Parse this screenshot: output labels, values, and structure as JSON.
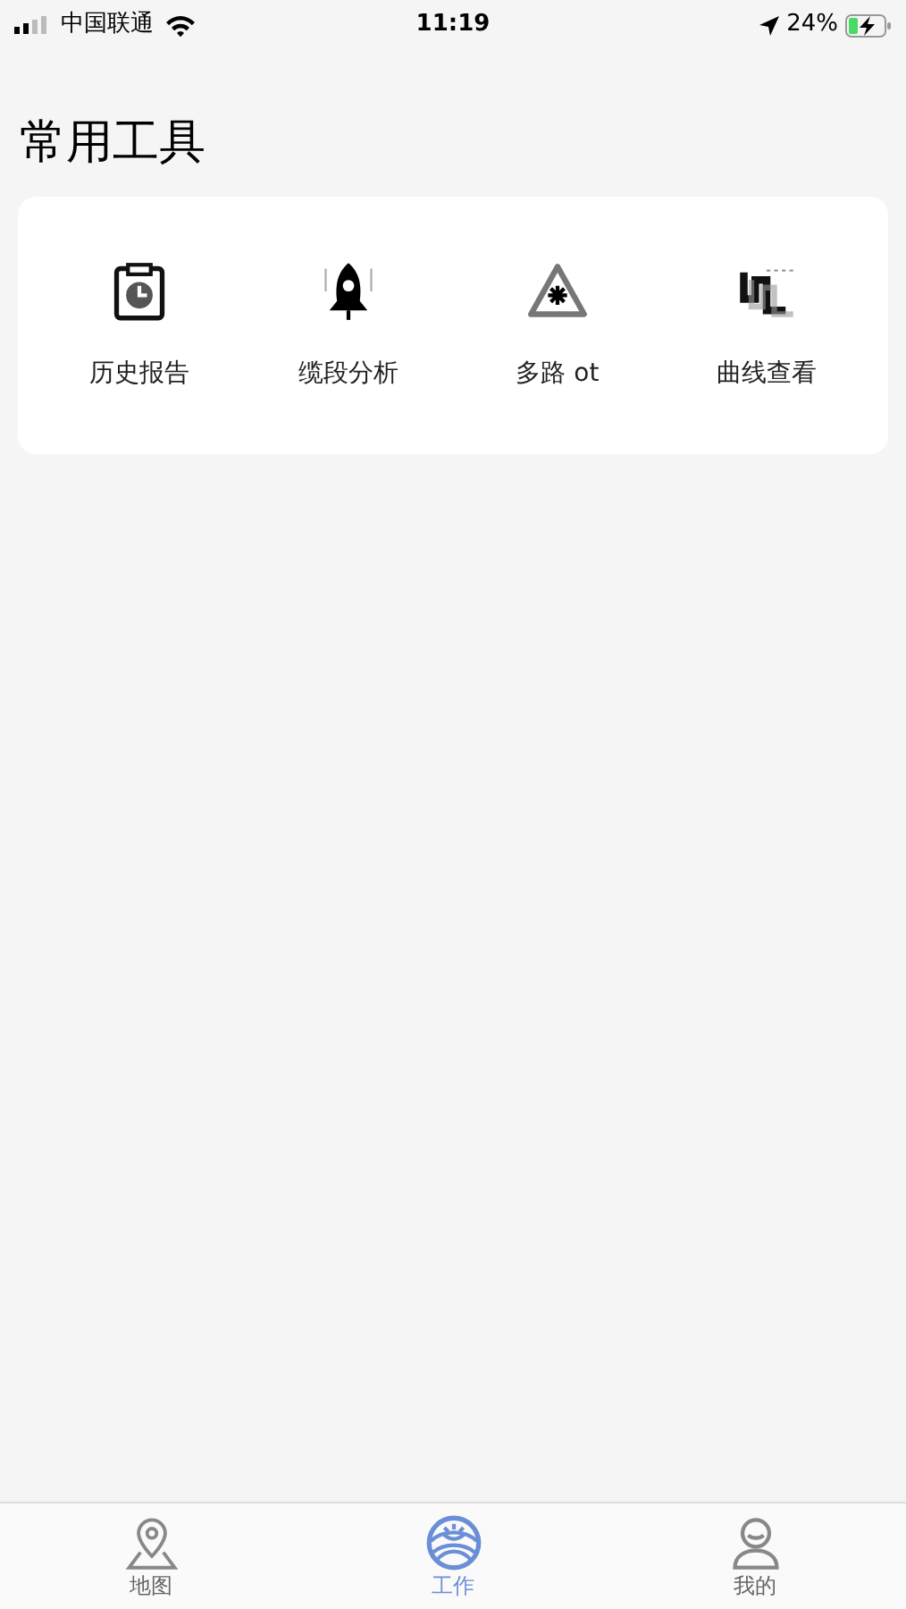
{
  "status_bar": {
    "carrier": "中国联通",
    "time": "11:19",
    "battery": "24%"
  },
  "section_title": "常用工具",
  "tools": [
    {
      "kind": "report",
      "label": "历史报告"
    },
    {
      "kind": "rocket",
      "label": "缆段分析"
    },
    {
      "kind": "hazard",
      "label": "多路 ot"
    },
    {
      "kind": "curve",
      "label": "曲线查看"
    }
  ],
  "tab_bar": [
    {
      "kind": "map",
      "label": "地图",
      "selected": false
    },
    {
      "kind": "work",
      "label": "工作",
      "selected": true
    },
    {
      "kind": "profile",
      "label": "我的",
      "selected": false
    }
  ]
}
